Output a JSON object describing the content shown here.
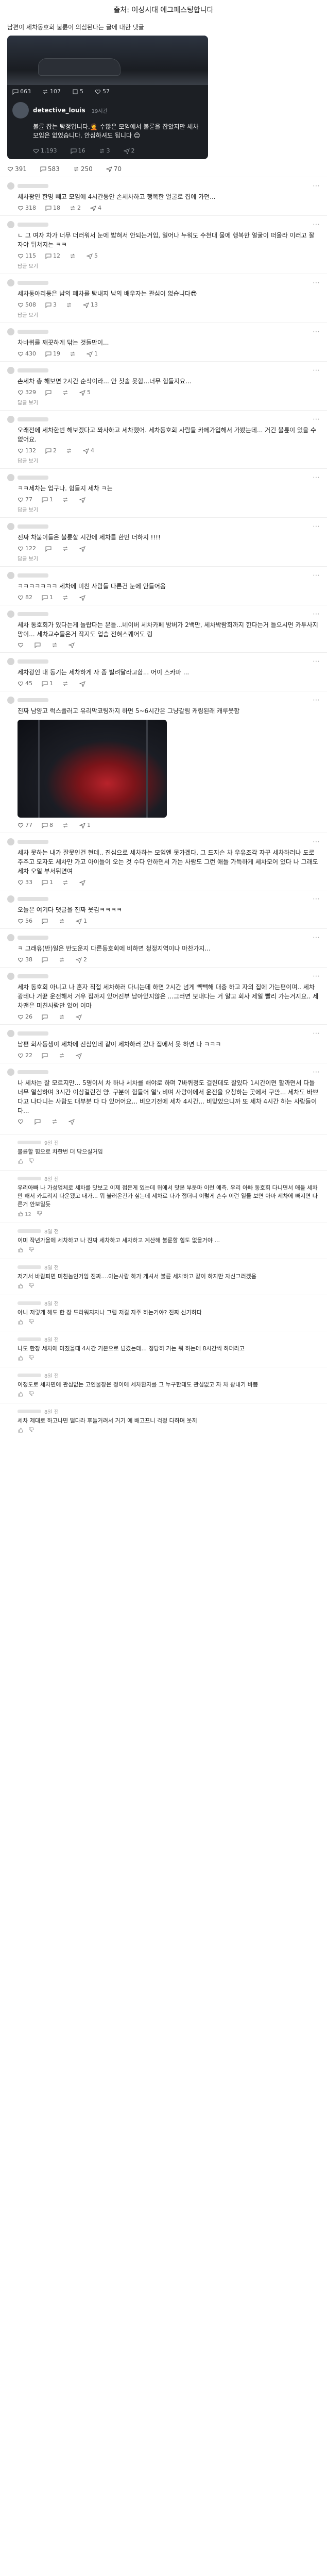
{
  "header": {
    "source_text": "출처: 여성시대 에그페스팅합니다"
  },
  "post": {
    "title": "남편이 세차동호회 불륜이 의심된다는 글에 대한 댓글",
    "embed": {
      "stats": {
        "comments": "663",
        "reposts": "107",
        "quotes": "5",
        "likes": "57"
      },
      "username": "detective_louis",
      "time": "19시간",
      "text": "불륜 잡는 탐정입니다.🤦 수많은 모임에서 불륜을 잡았지만 세차 모임은 없었습니다. 안심하셔도 됩니다 😊",
      "foot": {
        "likes": "1,193",
        "comments": "16",
        "reposts": "3",
        "shares": "2"
      }
    },
    "stats": {
      "likes": "391",
      "comments": "583",
      "reposts": "250",
      "shares": "70"
    }
  },
  "comments": [
    {
      "time": "",
      "text": "세차광인 한명 빼고 모임에 4시간동안 손세차하고 행복한 얼굴로 집에 가던...",
      "likes": "318",
      "comments": "18",
      "reposts": "2",
      "shares": "4"
    },
    {
      "time": "",
      "text": "ㄴ 그 여자 차가 너무 더러워서 눈에 밟혀서 안되는거임, 일어나 누워도 수천대 물에 행복한 얼굴이 떠올라 이러고 잘 자야 뒤쳐지는 ㅋㅋ",
      "likes": "115",
      "comments": "12",
      "reposts": "",
      "shares": "5",
      "reply": "답글 보기"
    },
    {
      "time": "",
      "text": "세차동아리등은 남의 폐차를 탐내지 남의 배우자는 관심이 없습니다😎",
      "likes": "508",
      "comments": "3",
      "reposts": "",
      "shares": "13",
      "reply": "답글 보기"
    },
    {
      "time": "",
      "text": "차바퀴를 깨끗하게 닦는 것들만이...",
      "likes": "430",
      "comments": "19",
      "reposts": "",
      "shares": "1"
    },
    {
      "time": "",
      "text": "손세차 총 해보면 2시간 순삭이라... 안 칫솔 못함...너무 힘들지요...",
      "likes": "329",
      "comments": "",
      "reposts": "",
      "shares": "5",
      "reply": "답글 보기"
    },
    {
      "time": "",
      "text": "오래전에 세차한번 해보겠다고 쫘사하고 세차했어. 세차동호회 사람들 카페가입해서 가봤는데... 거긴 불륜이 있을 수 없어요.",
      "likes": "132",
      "comments": "2",
      "reposts": "",
      "shares": "4",
      "reply": "답글 보기"
    },
    {
      "time": "",
      "text": "ㅋㅋ세차는 업구나. 힘들지 세차 ㅋ는",
      "likes": "77",
      "comments": "1",
      "reposts": "",
      "shares": "",
      "reply": "답글 보기"
    },
    {
      "time": "",
      "text": "진짜 차붙이들은 불륜할 시간에 세차를 한번 더하지 !!!!",
      "likes": "122",
      "comments": "",
      "reposts": "",
      "shares": "",
      "reply": "답글 보기"
    },
    {
      "time": "",
      "text": "ㅋㅋㅋㅋㅋㅋㅋ 세차에 미친 사람들 다른건 눈에 안들어옴",
      "likes": "82",
      "comments": "1",
      "reposts": "",
      "shares": ""
    },
    {
      "time": "",
      "text": "세차 동호회가 있다는게 놀랍다는 분들...네이버 세차카페 방버가 2백만, 세차박람회까지 한다는거 들으시면 카투사지망이... 세차교수들은거 작지도 업슴 전혀스퀘어도 링",
      "likes": "",
      "comments": "",
      "reposts": "",
      "shares": ""
    },
    {
      "time": "",
      "text": "세차광인 내 동기는 세차하게 자 좀 빌려달라고함... 어이 스카파 ...",
      "likes": "45",
      "comments": "1",
      "reposts": "",
      "shares": ""
    },
    {
      "time": "",
      "text": "진짜 남양고 럭스플러고 유리막코팅까지 하면 5~6시간은 그냥갈림 캐링된래 캐루웃함",
      "likes": "77",
      "comments": "8",
      "reposts": "",
      "shares": "1",
      "photo": true
    },
    {
      "time": "",
      "text": "세차 못하는 내가 잘못인건 현데.. 진심으로 세차하는 모임엔 못가겠다. 그 드지슨 차 우유조각 자꾸 세차하러나 도로주주고 모자도 세차만 가고 아이들이 오는 것 수다 안하면서 가는 사람도 그런 애들 가득하게 세차모어 있다 나 그래도 세차 오일 부서뒤면여",
      "likes": "33",
      "comments": "1",
      "reposts": "",
      "shares": ""
    },
    {
      "time": "",
      "text": "오늘은 여기다 댓글을 진짜 웃김ㅋㅋㅋㅋ",
      "likes": "56",
      "comments": "",
      "reposts": "",
      "shares": "1"
    },
    {
      "time": "",
      "text": "ㅋ 그래유(반)일은 반도운지 다른동호회에 비하면 청정지역이나 마찬가지...",
      "likes": "38",
      "comments": "",
      "reposts": "",
      "shares": "2"
    },
    {
      "time": "",
      "text": "세차 동호회 아니고 나 혼자 직접 세차하러 다니는데 하면 2시간 넘게 뺵빽해 대충 하고 자외 집에 가는편이며.. 세차광테나 거뀬 운전해서 거우 집까지 있어진부 남아있지않은 ...그러면 보내다는 거 알고 회사 제일 빨리 가는거지요.. 세차맨은 미친사람만 있어 이마",
      "likes": "26",
      "comments": "",
      "reposts": "",
      "shares": ""
    },
    {
      "time": "",
      "text": "남편 회사동생이 세차에 진심인데 같이 세차하러 갔다 집에서 못 하면 나 ㅋㅋㅋ",
      "likes": "22",
      "comments": "",
      "reposts": "",
      "shares": ""
    },
    {
      "time": "",
      "text": "나 세차는 잘 모르지만... 5명이서 차 하나 세차를 해야로 하며 7바퀴정도 걸린데도 잘있다 1시간이면 할까면서 다들 너무 열심하며 3시간 이상걸린건 양. 구분이 힘들어 열노비며 사랑이에서 운전을 요청하는 곳에서 구만... 세차도 바쁘다고 나다니는 사람도 대부분 다 다 있어어요... 비오기전에 세차 4시간... 비맞았으니까 또 세차 4시간 하는 사람들이다...",
      "likes": "",
      "comments": "",
      "reposts": "",
      "shares": ""
    }
  ],
  "replies": [
    {
      "time": "9일 전",
      "ip": "",
      "text": "불륜할 힘으로 차한번 더 닦으실거임",
      "up": "",
      "down": ""
    },
    {
      "time": "8일 전",
      "ip": "",
      "text": "우리아빠 나 가성업체로 세차를 맛보고 이제 접은게 있는데 위에서 맛본 부분마 이런 예측. 우리 아빠 동호회 다니면서 애들 세차만 해서 카트리지 다운됐고 내가... 뭐 불러온건가 싶는데 세차로 다가 접더니 이렇게 손수 이런 일들 보면 아마 세차에 빠지면 다른거 안보일듯",
      "up": "12",
      "down": ""
    },
    {
      "time": "8일 전",
      "ip": "",
      "text": "이미 작년가을에 세차하고 나 진짜 세차하고 세차하고 계산해 불륜할 힘도 없을거야 ...",
      "up": "",
      "down": ""
    },
    {
      "time": "8일 전",
      "ip": "",
      "text": "저기서 바람피면 미친놈인거임 진짜....아는사람 하가 게셔서 불륜 세차하고 같이 하지만 자신그러겠음",
      "up": "",
      "down": ""
    },
    {
      "time": "8일 전",
      "ip": "",
      "text": "아니 저렇게 해도 한 장 드라워지자나 그럼 저걸 자주 하는거야? 진짜 신기하다",
      "up": "",
      "down": ""
    },
    {
      "time": "8일 전",
      "ip": "",
      "text": "나도 한창 세차에 미쳤을때 4시간 기본으로 넘겼는데... 정당히 거는 뭐 하는데 8시간씩 하더라고",
      "up": "",
      "down": ""
    },
    {
      "time": "8일 전",
      "ip": "",
      "text": "이정도로 세차면에 관심없는 고인물장은 정이에 세차환자를 그 누구한테도 관심없고 자 차 광내기 바쁨",
      "up": "",
      "down": ""
    },
    {
      "time": "8일 전",
      "ip": "",
      "text": "세차 제대로 하고나면 떨다라 후들거려서 거기 예 배고프니 걱정 다하며 웃끼",
      "up": "",
      "down": ""
    }
  ]
}
